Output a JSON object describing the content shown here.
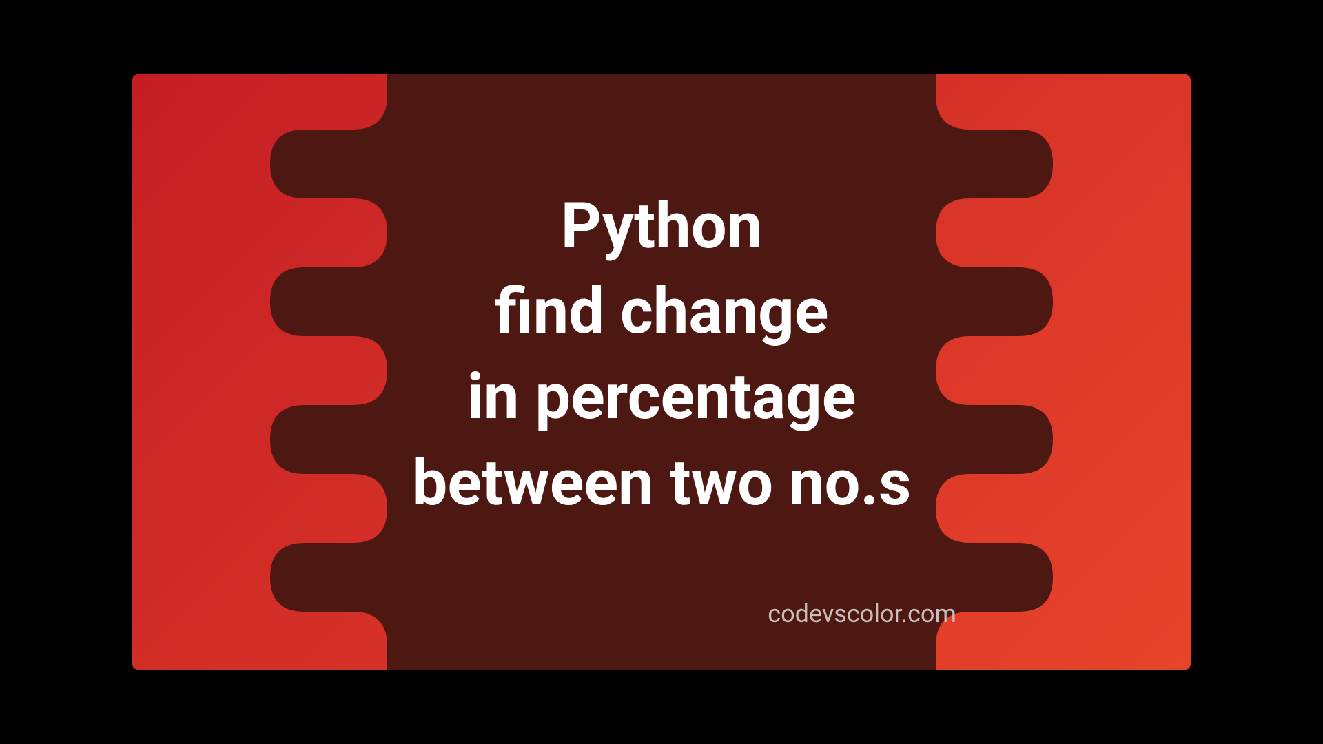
{
  "title": {
    "line1": "Python",
    "line2": "find change",
    "line3": "in percentage",
    "line4": "between two no.s"
  },
  "watermark": "codevscolor.com",
  "colors": {
    "gradient_start": "#c41e24",
    "gradient_end": "#e8442b",
    "blob": "#4d1712",
    "text": "#ffffff",
    "watermark": "#c9beb9"
  }
}
